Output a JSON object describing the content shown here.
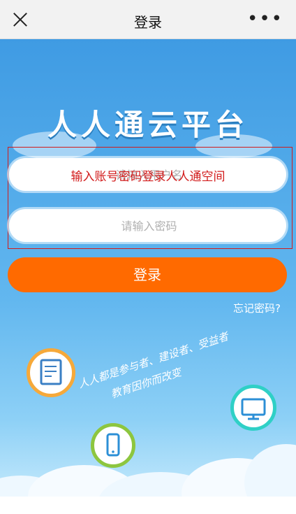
{
  "header": {
    "title": "登录"
  },
  "brand": {
    "title": "人人通云平台"
  },
  "form": {
    "hint_overlay": "输入账号密码登录人人通空间",
    "account_placeholder": "请输入用户名",
    "password_placeholder": "请输入密码",
    "login_label": "登录",
    "forgot_label": "忘记密码?"
  },
  "slogan": {
    "line1": "人人都是参与者、建设者、受益者",
    "line2": "教育因你而改变"
  },
  "icons": {
    "close": "close-icon",
    "more": "more-icon",
    "doc": "document-icon",
    "phone": "phone-icon",
    "monitor": "monitor-icon"
  },
  "colors": {
    "accent": "#ff6a00",
    "sky": "#3f9be3",
    "hint": "#d21b1b"
  }
}
